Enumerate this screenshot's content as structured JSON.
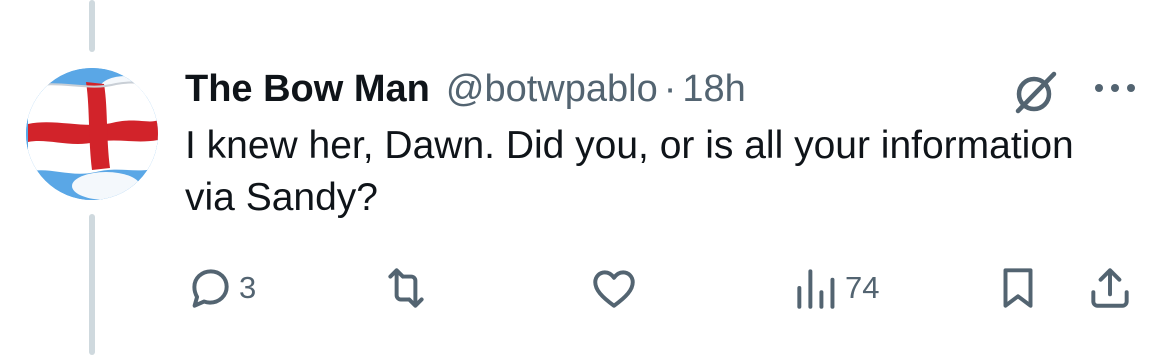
{
  "tweet": {
    "author_name": "The Bow Man",
    "handle": "@botwpablo",
    "separator": "·",
    "time": "18h",
    "text": "I knew her, Dawn. Did you, or is all your information via Sandy?",
    "avatar_icon": "england-flag-icon"
  },
  "actions": {
    "reply_count": "3",
    "retweet_count": "",
    "like_count": "",
    "views_count": "74"
  },
  "colors": {
    "text_primary": "#0f1419",
    "text_secondary": "#536471",
    "thread_line": "#cfd9de"
  }
}
